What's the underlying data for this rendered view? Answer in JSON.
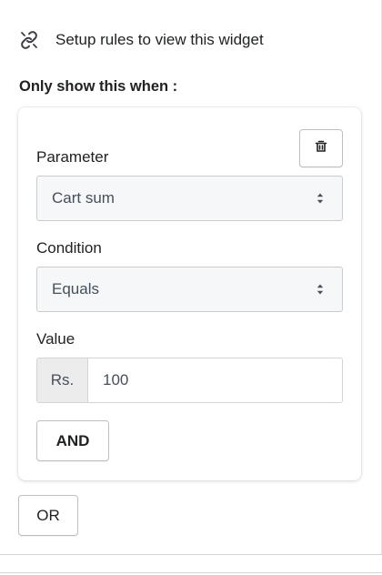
{
  "header": {
    "icon": "link-icon",
    "title": "Setup rules to view this widget"
  },
  "rules": {
    "heading": "Only show this when :",
    "delete_icon": "trash-icon",
    "parameter": {
      "label": "Parameter",
      "selected": "Cart sum"
    },
    "condition": {
      "label": "Condition",
      "selected": "Equals"
    },
    "value": {
      "label": "Value",
      "prefix": "Rs.",
      "current": "100"
    },
    "and_label": "AND"
  },
  "or_label": "OR",
  "colors": {
    "text": "#202223",
    "border": "#babfc3",
    "select_bg": "#f6f7f8",
    "prefix_bg": "#ececec"
  }
}
